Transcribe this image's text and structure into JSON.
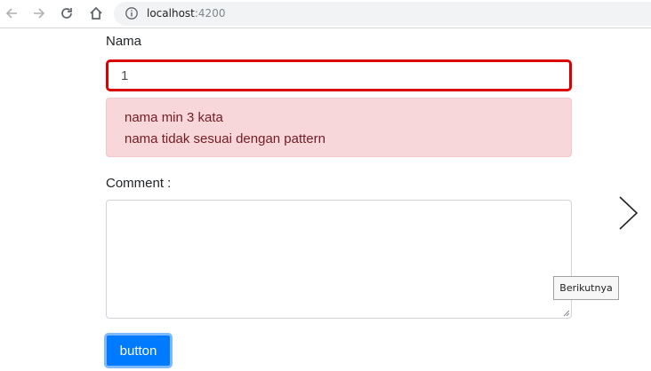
{
  "browser": {
    "url_host": "localhost",
    "url_port": ":4200",
    "icons": [
      "back-icon",
      "forward-icon",
      "reload-icon",
      "home-icon",
      "info-icon"
    ]
  },
  "form": {
    "name_label": "Nama",
    "name_value": "1",
    "errors": [
      "nama min 3 kata",
      "nama tidak sesuai dengan pattern"
    ],
    "comment_label": "Comment :",
    "comment_value": "",
    "submit_label": "button"
  },
  "overlay": {
    "next_tooltip": "Berikutnya"
  },
  "colors": {
    "error_border": "#dc0000",
    "alert_bg": "#f8d7da",
    "alert_text": "#721c24",
    "primary": "#007bff"
  }
}
